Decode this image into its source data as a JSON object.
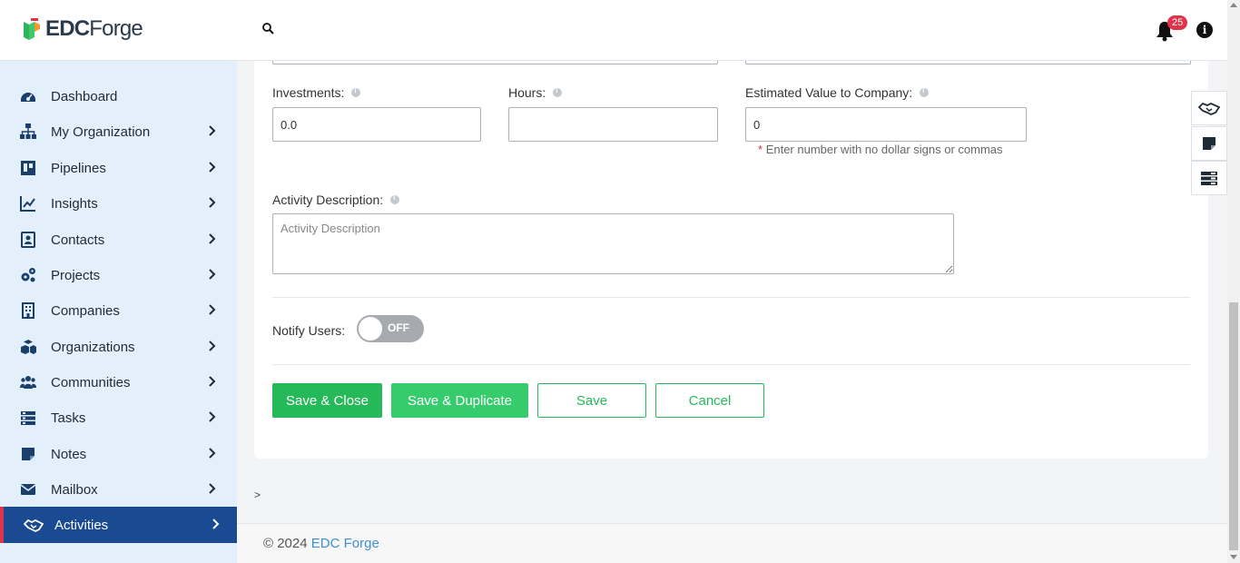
{
  "header": {
    "logo_bold": "EDC",
    "logo_light": "Forge",
    "notifications_count": "25",
    "info_label": "i"
  },
  "sidebar": {
    "items": [
      {
        "label": "Dashboard",
        "icon": "dashboard-icon",
        "has_chevron": false
      },
      {
        "label": "My Organization",
        "icon": "org-chart-icon",
        "has_chevron": true
      },
      {
        "label": "Pipelines",
        "icon": "pipeline-board-icon",
        "has_chevron": true
      },
      {
        "label": "Insights",
        "icon": "line-chart-icon",
        "has_chevron": true
      },
      {
        "label": "Contacts",
        "icon": "contact-card-icon",
        "has_chevron": true
      },
      {
        "label": "Projects",
        "icon": "gears-icon",
        "has_chevron": true
      },
      {
        "label": "Companies",
        "icon": "building-icon",
        "has_chevron": true
      },
      {
        "label": "Organizations",
        "icon": "cubes-icon",
        "has_chevron": true
      },
      {
        "label": "Communities",
        "icon": "users-icon",
        "has_chevron": true
      },
      {
        "label": "Tasks",
        "icon": "tasks-icon",
        "has_chevron": true
      },
      {
        "label": "Notes",
        "icon": "note-icon",
        "has_chevron": true
      },
      {
        "label": "Mailbox",
        "icon": "envelope-icon",
        "has_chevron": true
      },
      {
        "label": "Activities",
        "icon": "handshake-icon",
        "has_chevron": true,
        "active": true
      }
    ]
  },
  "form": {
    "investments_label": "Investments:",
    "investments_value": "0.0",
    "hours_label": "Hours:",
    "hours_value": "",
    "estimated_label": "Estimated Value to Company:",
    "estimated_value": "0",
    "estimated_hint": "Enter number with no dollar signs or commas",
    "hint_star": "*",
    "description_label": "Activity Description:",
    "description_placeholder": "Activity Description",
    "notify_label": "Notify Users:",
    "notify_state": "OFF"
  },
  "buttons": {
    "save_close": "Save & Close",
    "save_duplicate": "Save & Duplicate",
    "save": "Save",
    "cancel": "Cancel"
  },
  "breadcrumb": ">",
  "footer": {
    "copyright": "© 2024 ",
    "brand_link": "EDC Forge"
  },
  "colors": {
    "accent_green": "#26b95a",
    "sidebar_active": "#1a4a92",
    "sidebar_bg": "#e3f0fb",
    "badge_red": "#e0344b",
    "link_blue": "#3d8fd1"
  }
}
